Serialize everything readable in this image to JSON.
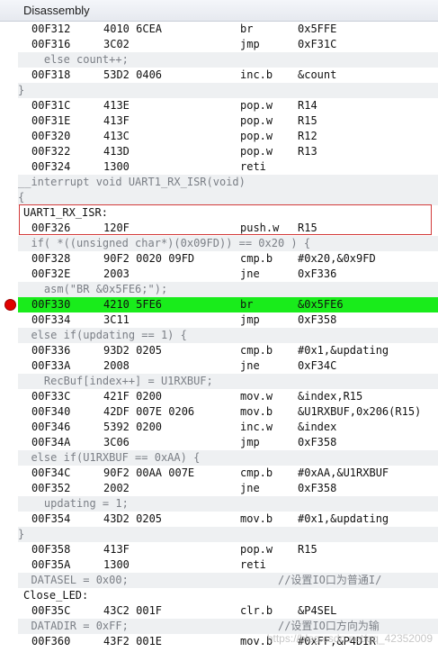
{
  "window": {
    "title": "Disassembly"
  },
  "rows": [
    {
      "type": "asm",
      "addr": "00F312",
      "op": "4010 6CEA",
      "mn": "br",
      "arg": "0x5FFE"
    },
    {
      "type": "asm",
      "addr": "00F316",
      "op": "3C02",
      "mn": "jmp",
      "arg": "0xF31C"
    },
    {
      "type": "src",
      "text": "    else count++;"
    },
    {
      "type": "asm",
      "addr": "00F318",
      "op": "53D2 0406",
      "mn": "inc.b",
      "arg": "&count"
    },
    {
      "type": "src",
      "text": "}"
    },
    {
      "type": "asm",
      "addr": "00F31C",
      "op": "413E",
      "mn": "pop.w",
      "arg": "R14"
    },
    {
      "type": "asm",
      "addr": "00F31E",
      "op": "413F",
      "mn": "pop.w",
      "arg": "R15"
    },
    {
      "type": "asm",
      "addr": "00F320",
      "op": "413C",
      "mn": "pop.w",
      "arg": "R12"
    },
    {
      "type": "asm",
      "addr": "00F322",
      "op": "413D",
      "mn": "pop.w",
      "arg": "R13"
    },
    {
      "type": "asm",
      "addr": "00F324",
      "op": "1300",
      "mn": "reti",
      "arg": ""
    },
    {
      "type": "src",
      "text": "__interrupt void UART1_RX_ISR(void)"
    },
    {
      "type": "src",
      "text": "{"
    },
    {
      "type": "label",
      "text": "UART1_RX_ISR:"
    },
    {
      "type": "asm",
      "addr": "00F326",
      "op": "120F",
      "mn": "push.w",
      "arg": "R15"
    },
    {
      "type": "src",
      "text": "  if( *((unsigned char*)(0x09FD)) == 0x20 ) {"
    },
    {
      "type": "asm",
      "addr": "00F328",
      "op": "90F2 0020 09FD",
      "mn": "cmp.b",
      "arg": "#0x20,&0x9FD"
    },
    {
      "type": "asm",
      "addr": "00F32E",
      "op": "2003",
      "mn": "jne",
      "arg": "0xF336"
    },
    {
      "type": "src",
      "text": "    asm(\"BR &0x5FE6;\");"
    },
    {
      "type": "asm",
      "addr": "00F330",
      "op": "4210 5FE6",
      "mn": "br",
      "arg": "&0x5FE6",
      "current": true
    },
    {
      "type": "asm",
      "addr": "00F334",
      "op": "3C11",
      "mn": "jmp",
      "arg": "0xF358"
    },
    {
      "type": "src",
      "text": "  else if(updating == 1) {"
    },
    {
      "type": "asm",
      "addr": "00F336",
      "op": "93D2 0205",
      "mn": "cmp.b",
      "arg": "#0x1,&updating"
    },
    {
      "type": "asm",
      "addr": "00F33A",
      "op": "2008",
      "mn": "jne",
      "arg": "0xF34C"
    },
    {
      "type": "src",
      "text": "    RecBuf[index++] = U1RXBUF;"
    },
    {
      "type": "asm",
      "addr": "00F33C",
      "op": "421F 0200",
      "mn": "mov.w",
      "arg": "&index,R15"
    },
    {
      "type": "asm",
      "addr": "00F340",
      "op": "42DF 007E 0206",
      "mn": "mov.b",
      "arg": "&U1RXBUF,0x206(R15)"
    },
    {
      "type": "asm",
      "addr": "00F346",
      "op": "5392 0200",
      "mn": "inc.w",
      "arg": "&index"
    },
    {
      "type": "asm",
      "addr": "00F34A",
      "op": "3C06",
      "mn": "jmp",
      "arg": "0xF358"
    },
    {
      "type": "src",
      "text": "  else if(U1RXBUF == 0xAA) {"
    },
    {
      "type": "asm",
      "addr": "00F34C",
      "op": "90F2 00AA 007E",
      "mn": "cmp.b",
      "arg": "#0xAA,&U1RXBUF"
    },
    {
      "type": "asm",
      "addr": "00F352",
      "op": "2002",
      "mn": "jne",
      "arg": "0xF358"
    },
    {
      "type": "src",
      "text": "    updating = 1;"
    },
    {
      "type": "asm",
      "addr": "00F354",
      "op": "43D2 0205",
      "mn": "mov.b",
      "arg": "#0x1,&updating"
    },
    {
      "type": "src",
      "text": "}"
    },
    {
      "type": "asm",
      "addr": "00F358",
      "op": "413F",
      "mn": "pop.w",
      "arg": "R15"
    },
    {
      "type": "asm",
      "addr": "00F35A",
      "op": "1300",
      "mn": "reti",
      "arg": ""
    },
    {
      "type": "src",
      "text": "  DATASEL = 0x00;                       //设置IO口为普通I/"
    },
    {
      "type": "label",
      "text": "Close_LED:"
    },
    {
      "type": "asm",
      "addr": "00F35C",
      "op": "43C2 001F",
      "mn": "clr.b",
      "arg": "&P4SEL"
    },
    {
      "type": "src",
      "text": "  DATADIR = 0xFF;                       //设置IO口方向为输"
    },
    {
      "type": "asm",
      "addr": "00F360",
      "op": "43F2 001E",
      "mn": "mov.b",
      "arg": "#0xFF,&P4DIR"
    }
  ],
  "watermark": "https://blog.csdn.net/qq_42352009"
}
